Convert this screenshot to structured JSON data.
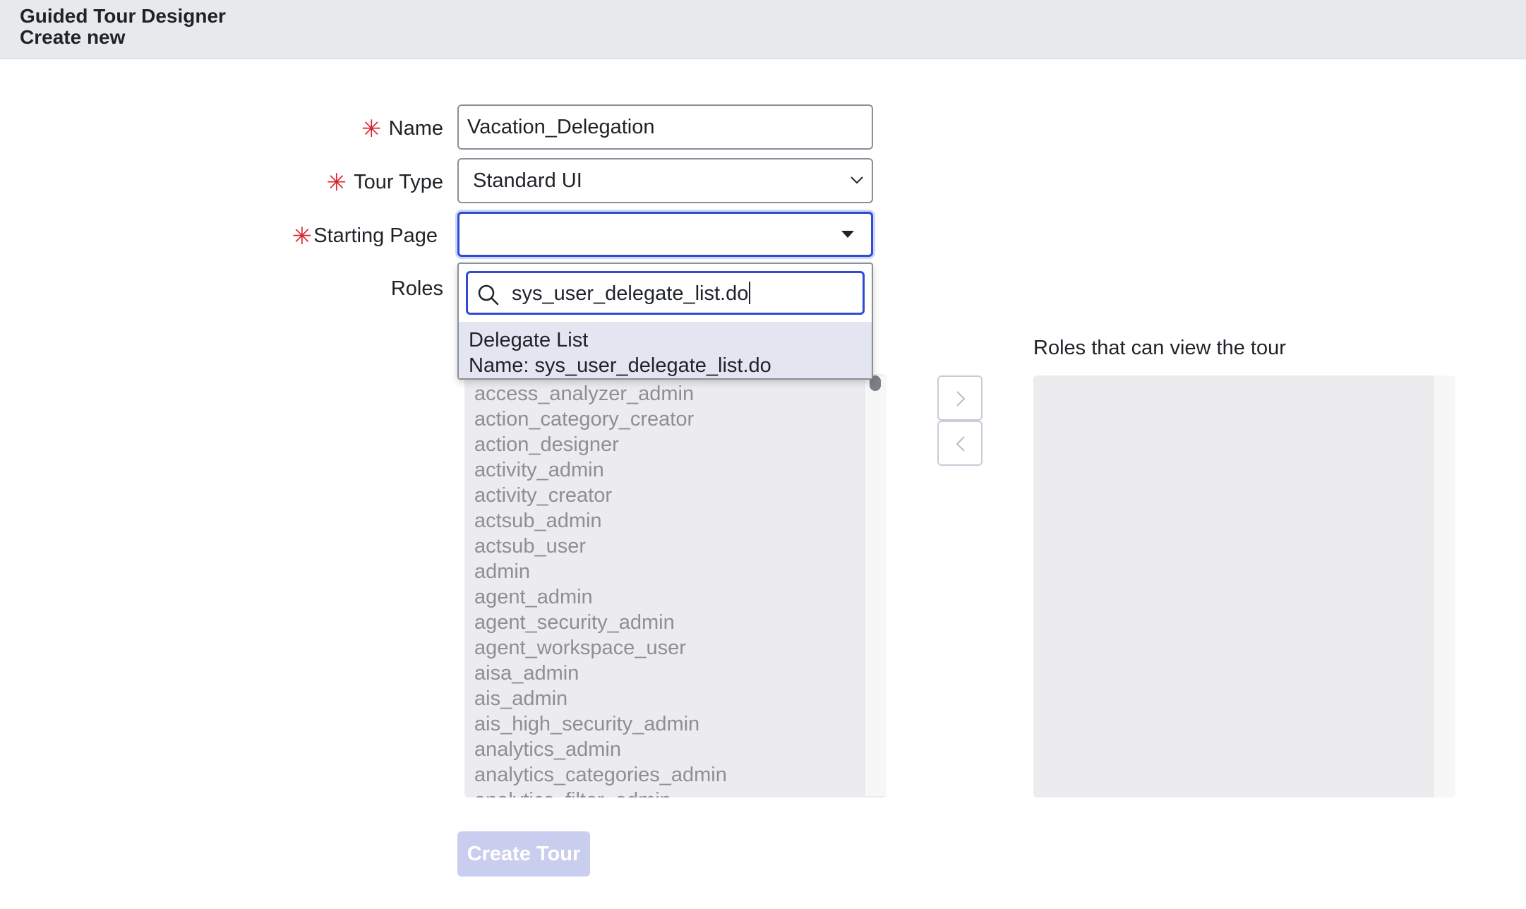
{
  "header": {
    "title": "Guided Tour Designer",
    "subtitle": "Create new"
  },
  "form": {
    "name_label": "Name",
    "name_value": "Vacation_Delegation",
    "tour_type_label": "Tour Type",
    "tour_type_value": "Standard UI",
    "starting_page_label": "Starting Page",
    "starting_page_value": "",
    "roles_label": "Roles",
    "required_marker": "✳"
  },
  "starting_page_dropdown": {
    "search_value": "sys_user_delegate_list.do",
    "option_title": "Delegate List",
    "option_subtitle": "Name: sys_user_delegate_list.do"
  },
  "roles": {
    "available": [
      "access_analyzer_admin",
      "action_category_creator",
      "action_designer",
      "activity_admin",
      "activity_creator",
      "actsub_admin",
      "actsub_user",
      "admin",
      "agent_admin",
      "agent_security_admin",
      "agent_workspace_user",
      "aisa_admin",
      "ais_admin",
      "ais_high_security_admin",
      "analytics_admin",
      "analytics_categories_admin",
      "analytics_filter_admin"
    ],
    "selected_label": "Roles that can view the tour",
    "selected": []
  },
  "actions": {
    "create_label": "Create Tour"
  },
  "colors": {
    "accent": "#2f4bd6",
    "required": "#d9232d",
    "disabled_button": "#c9cdee"
  }
}
